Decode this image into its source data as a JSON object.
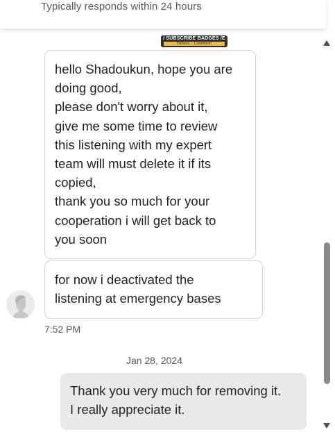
{
  "header": {
    "subtitle": "Typically responds within 24 hours"
  },
  "badge": {
    "title": "/ SUBSCRIBE BADGES /E",
    "strip": "Delivers ... Lunemtech"
  },
  "messages": [
    {
      "sender": "seller",
      "lines": [
        "hello Shadoukun, hope you are",
        "doing good,",
        "please don't worry about it,",
        "give me some time to review",
        "this listening with my expert",
        "team will must delete it if its",
        "copied,",
        "thank you so much for your",
        "cooperation i will get back to",
        "you soon"
      ]
    },
    {
      "sender": "seller",
      "lines": [
        "for now i deactivated the",
        "listening at emergency bases"
      ],
      "time": "7:52 PM"
    },
    {
      "sender": "me",
      "lines": [
        "Thank you very much for removing it.",
        "I really appreciate it."
      ]
    }
  ],
  "date_separator": "Jan 28, 2024",
  "icons": {
    "avatar": "default-user-avatar-icon",
    "scroll_up": "triangle-up-icon",
    "scroll_down": "triangle-down-icon"
  },
  "colors": {
    "received_bubble_border": "#d4d4d4",
    "sent_bubble_bg": "#e9e9e9",
    "meta_text": "#595959"
  }
}
